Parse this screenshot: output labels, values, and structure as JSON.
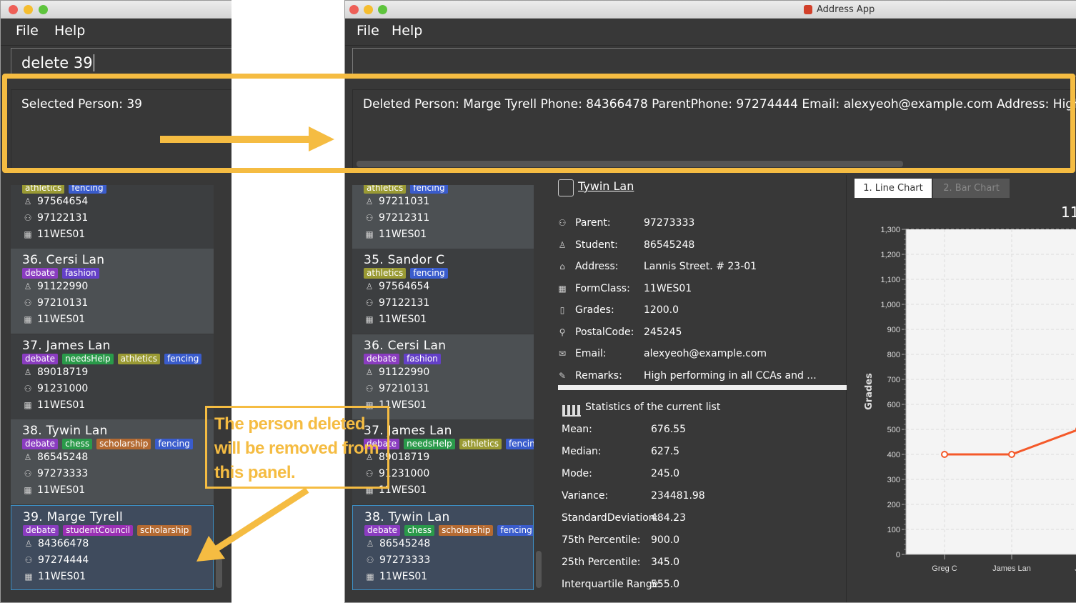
{
  "left_window": {
    "menu": [
      "File",
      "Help"
    ],
    "command_input": "delete 39",
    "result": "Selected Person: 39",
    "cards": [
      {
        "name": "",
        "tags": [
          {
            "t": "athletics",
            "c": "#9a9a34"
          },
          {
            "t": "fencing",
            "c": "#3a5ccc"
          }
        ],
        "student": "97564654",
        "parent": "97122131",
        "form": "11WES01",
        "style": "dark"
      },
      {
        "name": "36.  Cersi Lan",
        "tags": [
          {
            "t": "debate",
            "c": "#8a3cc0"
          },
          {
            "t": "fashion",
            "c": "#6440c8"
          }
        ],
        "student": "91122990",
        "parent": "97210131",
        "form": "11WES01",
        "style": "light"
      },
      {
        "name": "37.  James Lan",
        "tags": [
          {
            "t": "debate",
            "c": "#8a3cc0"
          },
          {
            "t": "needsHelp",
            "c": "#2a9a4a"
          },
          {
            "t": "athletics",
            "c": "#9a9a34"
          },
          {
            "t": "fencing",
            "c": "#3a5ccc"
          }
        ],
        "student": "89018719",
        "parent": "91231000",
        "form": "11WES01",
        "style": "dark"
      },
      {
        "name": "38.  Tywin Lan",
        "tags": [
          {
            "t": "debate",
            "c": "#8a3cc0"
          },
          {
            "t": "chess",
            "c": "#2a9a4a"
          },
          {
            "t": "scholarship",
            "c": "#b46a32"
          },
          {
            "t": "fencing",
            "c": "#3a5ccc"
          }
        ],
        "student": "86545248",
        "parent": "97273333",
        "form": "11WES01",
        "style": "light"
      },
      {
        "name": "39.  Marge Tyrell",
        "tags": [
          {
            "t": "debate",
            "c": "#8a3cc0"
          },
          {
            "t": "studentCouncil",
            "c": "#9a30b4"
          },
          {
            "t": "scholarship",
            "c": "#b46a32"
          }
        ],
        "student": "84366478",
        "parent": "97274444",
        "form": "11WES01",
        "style": "selected"
      }
    ]
  },
  "right_window": {
    "title": "Address App",
    "menu": [
      "File",
      "Help"
    ],
    "command_input": "",
    "result": "Deleted Person: Marge Tyrell Phone: 84366478 ParentPhone: 97274444 Email: alexyeoh@example.com Address: High Towers",
    "cards": [
      {
        "name": "",
        "tags": [
          {
            "t": "athletics",
            "c": "#9a9a34"
          },
          {
            "t": "fencing",
            "c": "#3a5ccc"
          }
        ],
        "student": "97211031",
        "parent": "97212311",
        "form": "11WES01",
        "style": "light"
      },
      {
        "name": "35.  Sandor C",
        "tags": [
          {
            "t": "athletics",
            "c": "#9a9a34"
          },
          {
            "t": "fencing",
            "c": "#3a5ccc"
          }
        ],
        "student": "97564654",
        "parent": "97122131",
        "form": "11WES01",
        "style": "dark"
      },
      {
        "name": "36.  Cersi Lan",
        "tags": [
          {
            "t": "debate",
            "c": "#8a3cc0"
          },
          {
            "t": "fashion",
            "c": "#6440c8"
          }
        ],
        "student": "91122990",
        "parent": "97210131",
        "form": "11WES01",
        "style": "light"
      },
      {
        "name": "37.  James Lan",
        "tags": [
          {
            "t": "debate",
            "c": "#8a3cc0"
          },
          {
            "t": "needsHelp",
            "c": "#2a9a4a"
          },
          {
            "t": "athletics",
            "c": "#9a9a34"
          },
          {
            "t": "fencing",
            "c": "#3a5ccc"
          }
        ],
        "student": "89018719",
        "parent": "91231000",
        "form": "11WES01",
        "style": "dark"
      },
      {
        "name": "38.  Tywin Lan",
        "tags": [
          {
            "t": "debate",
            "c": "#8a3cc0"
          },
          {
            "t": "chess",
            "c": "#2a9a4a"
          },
          {
            "t": "scholarship",
            "c": "#b46a32"
          },
          {
            "t": "fencing",
            "c": "#3a5ccc"
          }
        ],
        "student": "86545248",
        "parent": "97273333",
        "form": "11WES01",
        "style": "selected"
      }
    ],
    "details": {
      "name": "Tywin Lan",
      "rows": [
        {
          "icon": "parent-icon",
          "label": "Parent:",
          "value": "97273333"
        },
        {
          "icon": "student-icon",
          "label": "Student:",
          "value": "86545248"
        },
        {
          "icon": "home-icon",
          "label": "Address:",
          "value": "Lannis Street. # 23-01"
        },
        {
          "icon": "formclass-icon",
          "label": "FormClass:",
          "value": "11WES01"
        },
        {
          "icon": "grades-icon",
          "label": "Grades:",
          "value": "1200.0"
        },
        {
          "icon": "location-pin-icon",
          "label": "PostalCode:",
          "value": "245245"
        },
        {
          "icon": "email-icon",
          "label": "Email:",
          "value": "alexyeoh@example.com"
        },
        {
          "icon": "pencil-icon",
          "label": "Remarks:",
          "value": "High performing in all CCAs and ..."
        }
      ]
    },
    "statistics": {
      "title": "Statistics of the current list",
      "rows": [
        {
          "label": "Mean:",
          "value": "676.55"
        },
        {
          "label": "Median:",
          "value": "627.5"
        },
        {
          "label": "Mode:",
          "value": "245.0"
        },
        {
          "label": "Variance:",
          "value": "234481.98"
        },
        {
          "label": "StandardDeviation:",
          "value": "484.23"
        },
        {
          "label": "75th Percentile:",
          "value": "900.0"
        },
        {
          "label": "25th Percentile:",
          "value": "345.0"
        },
        {
          "label": "Interquartile Range:",
          "value": "555.0"
        }
      ]
    },
    "chart_tabs": [
      {
        "label": "1. Line Chart",
        "active": true
      },
      {
        "label": "2. Bar Chart",
        "active": false
      }
    ]
  },
  "chart_data": {
    "type": "line",
    "title": "11",
    "ylabel": "Grades",
    "ylim": [
      0,
      1300
    ],
    "yticks": [
      "0",
      "100",
      "200",
      "300",
      "400",
      "500",
      "600",
      "700",
      "800",
      "900",
      "1,000",
      "1,100",
      "1,200",
      "1,300"
    ],
    "categories": [
      "Greg C",
      "James Lan",
      "Jo"
    ],
    "values": [
      400,
      400,
      500
    ],
    "color": "#f4592a",
    "grid": true
  },
  "annotation": {
    "callout": "The person deleted will be removed from this panel.",
    "color": "#f5bc42"
  }
}
